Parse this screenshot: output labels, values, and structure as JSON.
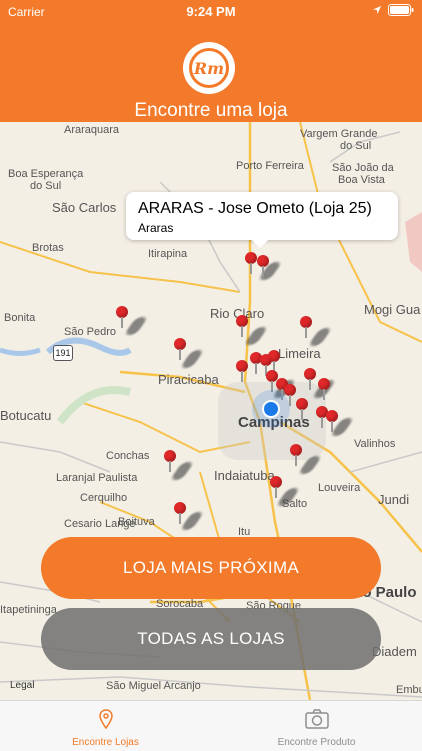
{
  "status_bar": {
    "carrier": "Carrier",
    "time": "9:24 PM"
  },
  "header": {
    "title": "Encontre uma loja",
    "logo_text": "Rm"
  },
  "callout": {
    "title": "ARARAS - Jose Ometo (Loja 25)",
    "subtitle": "Araras"
  },
  "map": {
    "cities": [
      {
        "name": "Araraquara"
      },
      {
        "name": "Vargem Grande"
      },
      {
        "name": "do Sul"
      },
      {
        "name": "Boa Esperança"
      },
      {
        "name": "do Sul"
      },
      {
        "name": "Porto Ferreira"
      },
      {
        "name": "São João da"
      },
      {
        "name": "Boa Vista"
      },
      {
        "name": "São Carlos"
      },
      {
        "name": "Itirapina"
      },
      {
        "name": "Brotas"
      },
      {
        "name": "Rio Claro"
      },
      {
        "name": "Mogi Gua"
      },
      {
        "name": "Bonita"
      },
      {
        "name": "São Pedro"
      },
      {
        "name": "Limeira"
      },
      {
        "name": "Piracicaba"
      },
      {
        "name": "Botucatu"
      },
      {
        "name": "Campinas"
      },
      {
        "name": "Valinhos"
      },
      {
        "name": "Conchas"
      },
      {
        "name": "Laranjal Paulista"
      },
      {
        "name": "Indaiatuba"
      },
      {
        "name": "Jundi"
      },
      {
        "name": "Cerquilho"
      },
      {
        "name": "Louveira"
      },
      {
        "name": "Cesario Lange"
      },
      {
        "name": "Salto"
      },
      {
        "name": "Boituva"
      },
      {
        "name": "Itu"
      },
      {
        "name": "Itapetininga"
      },
      {
        "name": "Sorocaba"
      },
      {
        "name": "São Roque"
      },
      {
        "name": "São Paulo"
      },
      {
        "name": "Diadem"
      },
      {
        "name": "São Miguel Arcanjo"
      },
      {
        "name": "Embu"
      }
    ],
    "highway": "191",
    "legal": "Legal"
  },
  "buttons": {
    "nearest": "LOJA MAIS PRÓXIMA",
    "all": "TODAS AS LOJAS"
  },
  "tabs": [
    {
      "label": "Encontre Lojas",
      "icon": "location-pin-icon"
    },
    {
      "label": "Encontre Produto",
      "icon": "camera-icon"
    }
  ],
  "colors": {
    "brand": "#f37a2a",
    "pin": "#e0282a",
    "user": "#1a7ae8"
  }
}
